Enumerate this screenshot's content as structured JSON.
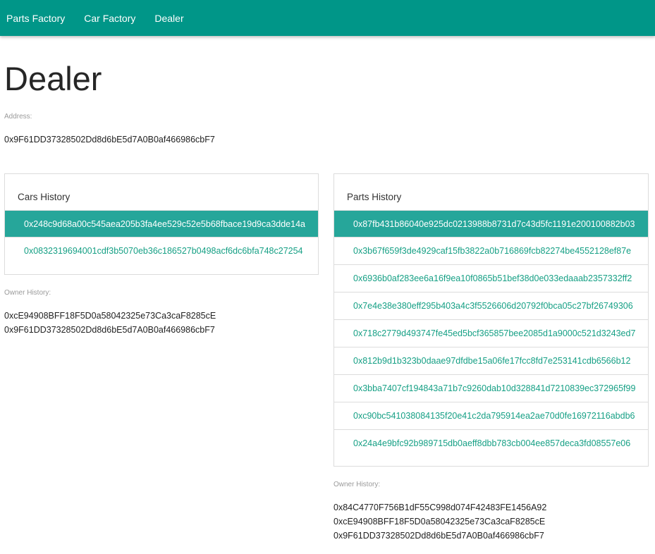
{
  "nav": {
    "items": [
      "Parts Factory",
      "Car Factory",
      "Dealer"
    ]
  },
  "page": {
    "title": "Dealer",
    "address_label": "Address:",
    "address": "0x9F61DD37328502Dd8d6bE5d7A0B0af466986cbF7"
  },
  "cars": {
    "title": "Cars History",
    "items": [
      "0x248c9d68a00c545aea205b3fa4ee529c52e5b68fbace19d9ca3dde14a",
      "0x0832319694001cdf3b5070eb36c186527b0498acf6dc6bfa748c27254"
    ],
    "owner_label": "Owner History:",
    "owners": [
      "0xcE94908BFF18F5D0a58042325e73Ca3caF8285cE",
      "0x9F61DD37328502Dd8d6bE5d7A0B0af466986cbF7"
    ]
  },
  "parts": {
    "title": "Parts History",
    "items": [
      "0x87fb431b86040e925dc0213988b8731d7c43d5fc1191e200100882b03",
      "0x3b67f659f3de4929caf15fb3822a0b716869fcb82274be4552128ef87e",
      "0x6936b0af283ee6a16f9ea10f0865b51bef38d0e033edaaab2357332ff2",
      "0x7e4e38e380eff295b403a4c3f5526606d20792f0bca05c27bf26749306",
      "0x718c2779d493747fe45ed5bcf365857bee2085d1a9000c521d3243ed7",
      "0x812b9d1b323b0daae97dfdbe15a06fe17fcc8fd7e253141cdb6566b12",
      "0x3bba7407cf194843a71b7c9260dab10d328841d7210839ec372965f99",
      "0xc90bc541038084135f20e41c2da795914ea2ae70d0fe16972116abdb6",
      "0x24a4e9bfc92b989715db0aeff8dbb783cb004ee857deca3fd08557e06"
    ],
    "owner_label": "Owner History:",
    "owners": [
      "0x84C4770F756B1dF55C998d074F42483FE1456A92",
      "0xcE94908BFF18F5D0a58042325e73Ca3caF8285cE",
      "0x9F61DD37328502Dd8d6bE5d7A0B0af466986cbF7"
    ]
  },
  "colors": {
    "navbar": "#009688",
    "active_row": "#26a69a",
    "link": "#16a085"
  }
}
